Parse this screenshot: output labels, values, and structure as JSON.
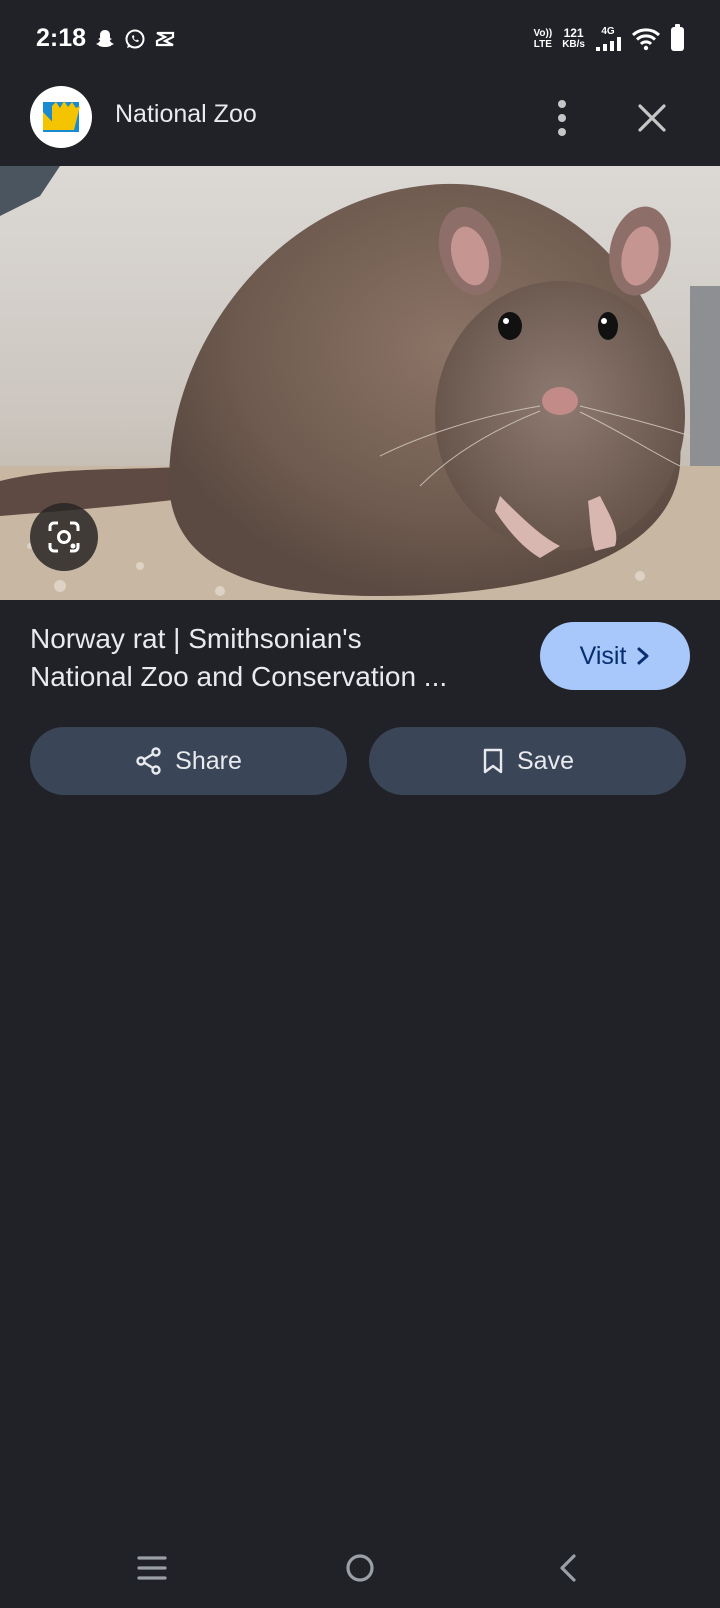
{
  "status_bar": {
    "time": "2:18",
    "left_icons": [
      "snapchat-icon",
      "whatsapp-icon",
      "capcut-icon"
    ],
    "volte_top": "Vo))",
    "volte_bottom": "LTE",
    "speed_value": "121",
    "speed_unit": "KB/s",
    "network": "4G",
    "icons": [
      "signal-icon",
      "wifi-icon",
      "battery-icon"
    ]
  },
  "header": {
    "title": "National Zoo",
    "logo_icon": "national-zoo-logo",
    "menu_icon": "more-vert-icon",
    "close_icon": "close-icon"
  },
  "image": {
    "lens_icon": "google-lens-icon"
  },
  "result": {
    "title_line1": "Norway rat | Smithsonian's",
    "title_line2": "National Zoo and Conservation ...",
    "visit_label": "Visit"
  },
  "actions": {
    "share_label": "Share",
    "save_label": "Save"
  },
  "nav": {
    "icons": [
      "recents-icon",
      "home-icon",
      "back-icon"
    ]
  },
  "colors": {
    "background": "#212227",
    "visit_button": "#a8c7fa",
    "action_button": "#3a4558"
  }
}
